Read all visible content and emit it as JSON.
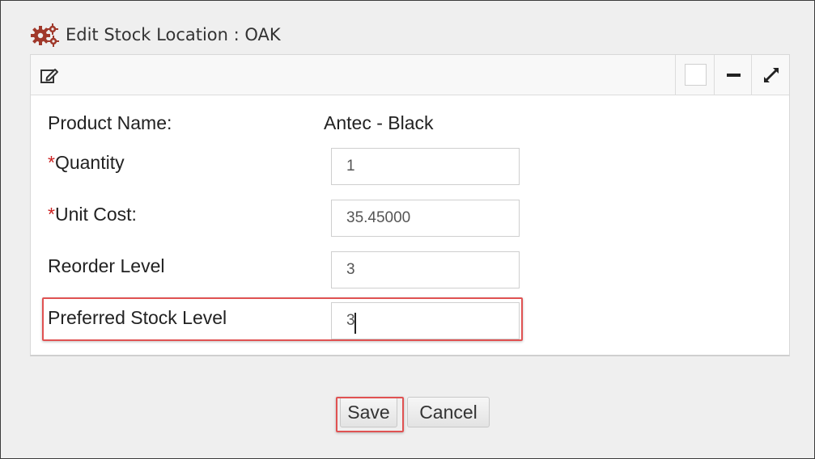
{
  "dialog": {
    "title": "Edit Stock Location : OAK",
    "title_icon": "gears-icon",
    "accent_color": "#a0392b"
  },
  "panel": {
    "header_icon": "edit-icon",
    "controls": {
      "box_icon": "square-icon",
      "minimize_icon": "minimize-icon",
      "maximize_icon": "expand-icon"
    }
  },
  "form": {
    "product_name": {
      "label": "Product Name:",
      "value": "Antec - Black"
    },
    "quantity": {
      "required_mark": "*",
      "label": "Quantity",
      "value": "1"
    },
    "unit_cost": {
      "required_mark": "*",
      "label": "Unit Cost:",
      "value": "35.45000"
    },
    "reorder_level": {
      "label": "Reorder Level",
      "value": "3"
    },
    "preferred_stock_level": {
      "label": "Preferred Stock Level",
      "value": "3"
    }
  },
  "buttons": {
    "save_label": "Save",
    "cancel_label": "Cancel"
  },
  "highlight_color": "#e05252"
}
